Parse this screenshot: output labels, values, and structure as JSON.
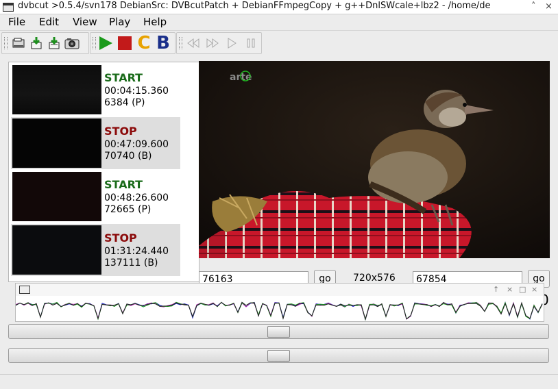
{
  "window": {
    "title": "dvbcut >0.5.4/svn178 DebianSrc: DVBcutPatch + DebianFFmpegCopy + g++DnlSWcale+lbz2 - /home/de",
    "controls": [
      "˄",
      "×"
    ]
  },
  "menu": {
    "items": [
      {
        "label": "File",
        "name": "menu-file"
      },
      {
        "label": "Edit",
        "name": "menu-edit"
      },
      {
        "label": "View",
        "name": "menu-view"
      },
      {
        "label": "Play",
        "name": "menu-play"
      },
      {
        "label": "Help",
        "name": "menu-help"
      }
    ]
  },
  "toolbar": {
    "buttons": [
      {
        "name": "open-button",
        "icon": "open-file-icon"
      },
      {
        "name": "save-button",
        "icon": "save-download-icon"
      },
      {
        "name": "export-button",
        "icon": "export-icon"
      },
      {
        "name": "snapshot-button",
        "icon": "camera-icon"
      },
      {
        "name": "start-marker-button",
        "icon": "green-play-icon"
      },
      {
        "name": "stop-marker-button",
        "icon": "red-stop-icon"
      },
      {
        "name": "chapter-marker-button",
        "label": "C",
        "icon": "chapter-c-icon"
      },
      {
        "name": "bookmark-button",
        "label": "B",
        "icon": "bookmark-b-icon"
      },
      {
        "name": "rewind-button",
        "icon": "rewind-icon"
      },
      {
        "name": "fast-forward-button",
        "icon": "fast-forward-icon"
      },
      {
        "name": "play-button",
        "icon": "play-icon"
      },
      {
        "name": "pause-button",
        "icon": "pause-icon"
      }
    ],
    "colors": {
      "chapter": "#e8a200",
      "bookmark": "#1a2f8a",
      "start": "#1b9a1b",
      "stop": "#c21a1a"
    }
  },
  "markers": [
    {
      "type": "START",
      "time": "00:04:15.360",
      "frame": "6384 (P)",
      "color": "#1a6b1a"
    },
    {
      "type": "STOP",
      "time": "00:47:09.600",
      "frame": "70740 (B)",
      "color": "#8b0a0a"
    },
    {
      "type": "START",
      "time": "00:48:26.600",
      "frame": "72665 (P)",
      "color": "#1a6b1a"
    },
    {
      "type": "STOP",
      "time": "01:31:24.440",
      "frame": "137111 (B)",
      "color": "#8b0a0a"
    }
  ],
  "video": {
    "channel_logo": "arte"
  },
  "controls": {
    "left_frame": "76163",
    "go_label": "go",
    "resolution": "720x576",
    "right_frame": "67854"
  },
  "floating_window": {
    "controls": [
      "↑",
      "×",
      "□",
      "×"
    ],
    "partial_text": "0"
  },
  "sliders": {
    "upper": {
      "position_fraction": 0.5
    },
    "lower": {
      "position_fraction": 0.5
    }
  }
}
